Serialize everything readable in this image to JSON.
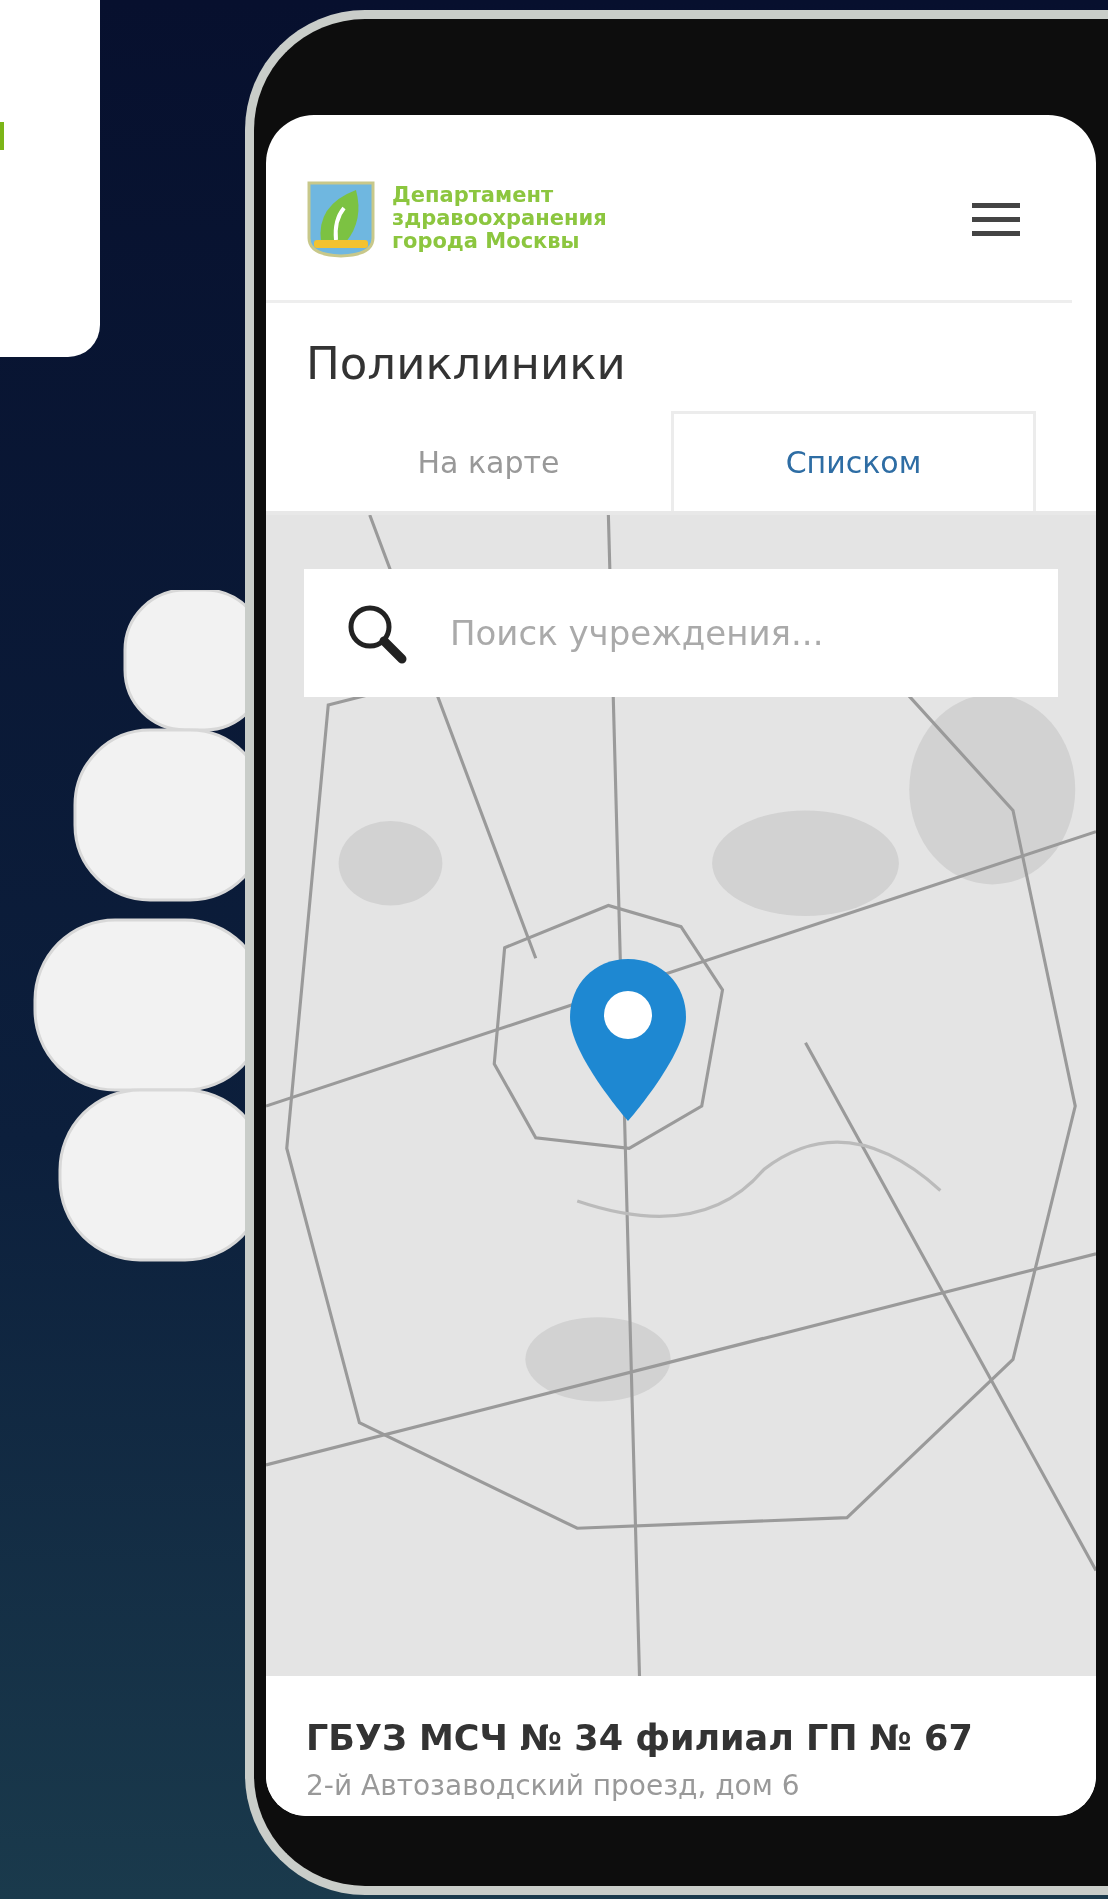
{
  "header": {
    "logo_lines": [
      "Департамент",
      "здравоохранения",
      "города Москвы"
    ]
  },
  "title": "Поликлиники",
  "tabs": [
    {
      "label": "На карте",
      "selected": false
    },
    {
      "label": "Списком",
      "selected": true
    }
  ],
  "search": {
    "placeholder": "Поиск учреждения..."
  },
  "result": {
    "name": "ГБУЗ МСЧ № 34 филиал ГП № 67",
    "address": "2-й Автозаводский проезд, дом 6"
  }
}
